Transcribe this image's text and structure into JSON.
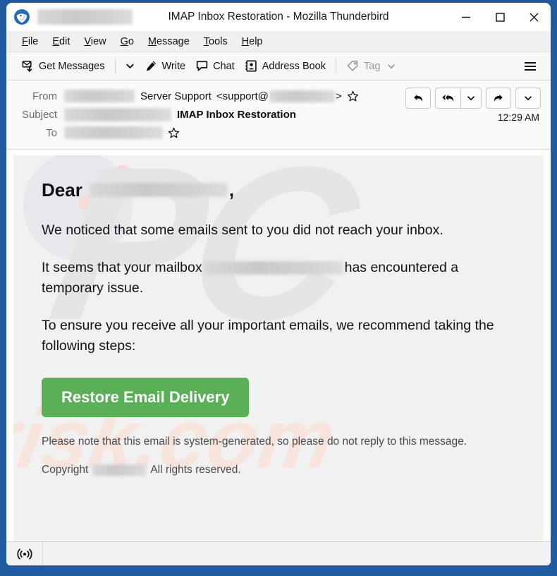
{
  "window": {
    "title": "IMAP Inbox Restoration - Mozilla Thunderbird",
    "app_logo": "thunderbird-icon",
    "controls": {
      "minimize": "minimize-icon",
      "maximize": "maximize-icon",
      "close": "close-icon"
    }
  },
  "menubar": {
    "items": [
      {
        "accel": "F",
        "rest": "ile"
      },
      {
        "accel": "E",
        "rest": "dit"
      },
      {
        "accel": "V",
        "rest": "iew"
      },
      {
        "accel": "G",
        "rest": "o"
      },
      {
        "accel": "M",
        "rest": "essage"
      },
      {
        "accel": "T",
        "rest": "ools"
      },
      {
        "accel": "H",
        "rest": "elp"
      }
    ]
  },
  "toolbar": {
    "get_messages": "Get Messages",
    "get_messages_caret": "chevron-down-icon",
    "write": "Write",
    "chat": "Chat",
    "address_book": "Address Book",
    "tag": "Tag",
    "tag_caret": "chevron-down-icon",
    "app_menu": "hamburger-menu-icon"
  },
  "message_header": {
    "from_label": "From",
    "from_display_name": "Server Support",
    "from_address_prefix": "<support@",
    "from_address_suffix": ">",
    "subject_label": "Subject",
    "subject": "IMAP Inbox Restoration",
    "to_label": "To",
    "time": "12:29 AM",
    "actions": {
      "reply": "reply-icon",
      "reply_all": "reply-all-icon",
      "reply_more": "chevron-down-icon",
      "forward": "forward-icon",
      "more": "chevron-down-icon"
    },
    "star": "star-icon"
  },
  "email": {
    "greeting_prefix": "Dear",
    "greeting_suffix": ",",
    "paragraph_1": "We noticed that some emails sent to you did not reach your inbox.",
    "paragraph_2_before": "It seems that your mailbox",
    "paragraph_2_after": "has encountered a temporary issue.",
    "paragraph_3": "To ensure you receive all your important emails, we recommend taking the following steps:",
    "cta_label": "Restore Email Delivery",
    "disclaimer": "Please note that this email is system-generated, so please do not reply to this message.",
    "copyright_prefix": "Copyright",
    "copyright_suffix": "All rights reserved.",
    "watermark_pc": "PC",
    "watermark_risk": "risk.com"
  },
  "statusbar": {
    "connection_icon": "broadcast-signal-icon"
  },
  "colors": {
    "desktop": "#1f5b9e",
    "cta_green": "#5aaf57",
    "email_card_bg": "#f1f1f1",
    "toolbar_bg": "#f7f7f7",
    "menubar_bg": "#f0f0f0"
  }
}
